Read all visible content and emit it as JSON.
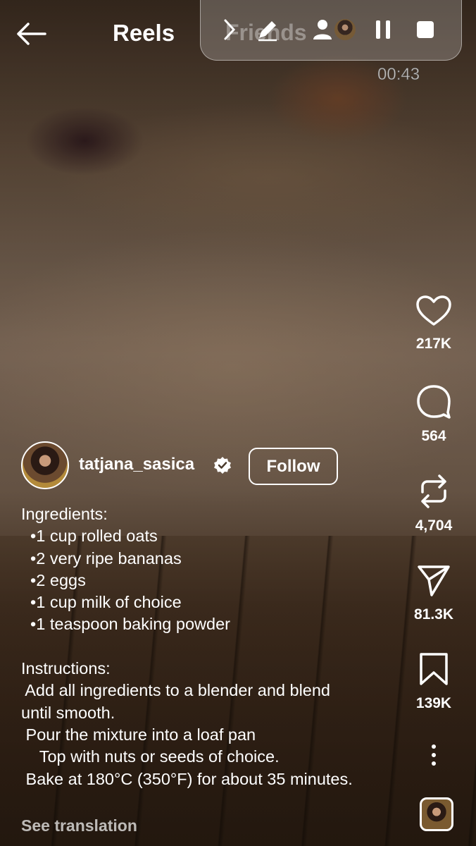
{
  "header": {
    "title": "Reels",
    "ghost_text": "Friends",
    "timer": "00:43"
  },
  "actions": [
    {
      "name": "like",
      "icon": "heart-icon",
      "count": "217K"
    },
    {
      "name": "comment",
      "icon": "comment-icon",
      "count": "564"
    },
    {
      "name": "remix",
      "icon": "repost-icon",
      "count": "4,704"
    },
    {
      "name": "share",
      "icon": "send-icon",
      "count": "81.3K"
    },
    {
      "name": "save",
      "icon": "bookmark-icon",
      "count": "139K"
    }
  ],
  "author": {
    "username": "tatjana_sasica",
    "follow_label": "Follow"
  },
  "caption": {
    "lines": [
      "Ingredients:",
      "  •1 cup rolled oats",
      "  •2 very ripe bananas",
      "  •2 eggs",
      "  •1 cup milk of choice",
      "  •1 teaspoon baking powder",
      "",
      "Instructions:",
      " Add all ingredients to a blender and blend",
      "until smooth.",
      " Pour the mixture into a loaf pan",
      "    Top with nuts or seeds of choice.",
      " Bake at 180°C (350°F) for about 35 minutes."
    ],
    "see_translation": "See translation"
  }
}
